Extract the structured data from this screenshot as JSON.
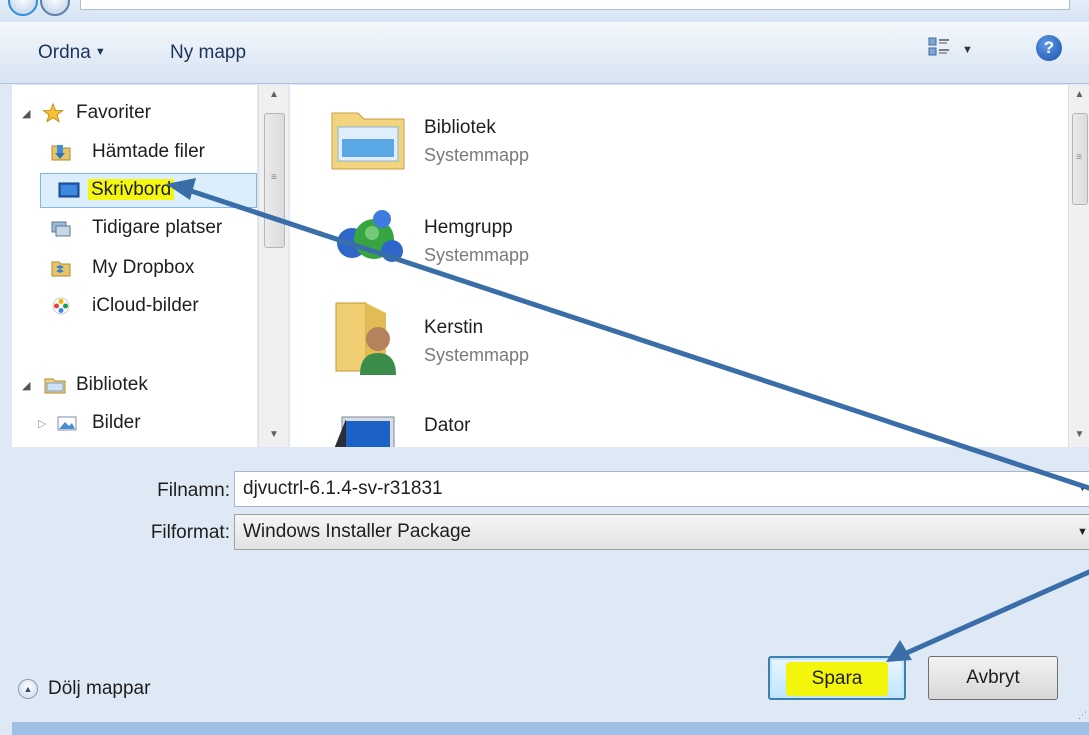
{
  "toolbar": {
    "organize_label": "Ordna",
    "new_folder_label": "Ny mapp",
    "help_label": "?"
  },
  "nav": {
    "favorites": {
      "label": "Favoriter",
      "items": [
        {
          "label": "Hämtade filer",
          "icon": "downloads-folder-icon"
        },
        {
          "label": "Skrivbord",
          "icon": "desktop-icon",
          "selected": true,
          "highlighted": true
        },
        {
          "label": "Tidigare platser",
          "icon": "recent-places-icon"
        },
        {
          "label": "My Dropbox",
          "icon": "dropbox-folder-icon"
        },
        {
          "label": "iCloud-bilder",
          "icon": "icloud-photos-icon"
        }
      ]
    },
    "libraries": {
      "label": "Bibliotek",
      "items": [
        {
          "label": "Bilder",
          "icon": "pictures-library-icon"
        }
      ]
    }
  },
  "content": {
    "items": [
      {
        "name": "Bibliotek",
        "type": "Systemmapp",
        "icon": "libraries-folder-icon"
      },
      {
        "name": "Hemgrupp",
        "type": "Systemmapp",
        "icon": "homegroup-icon"
      },
      {
        "name": "Kerstin",
        "type": "Systemmapp",
        "icon": "user-folder-icon"
      },
      {
        "name": "Dator",
        "type": "",
        "icon": "computer-icon"
      }
    ]
  },
  "form": {
    "filename_label": "Filnamn:",
    "filename_value": "djvuctrl-6.1.4-sv-r31831",
    "filetype_label": "Filformat:",
    "filetype_value": "Windows Installer Package"
  },
  "footer": {
    "hide_folders_label": "Dölj mappar",
    "save_label": "Spara",
    "cancel_label": "Avbryt"
  },
  "colors": {
    "highlight": "#f5f70e",
    "annotation_arrow": "#3a6ea8",
    "selection": "#dceefc"
  }
}
